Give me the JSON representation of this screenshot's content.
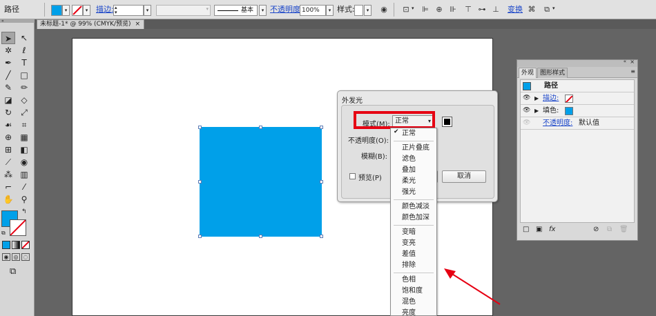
{
  "control_bar": {
    "object_type": "路径",
    "stroke_label": "描边:",
    "line_style": "基本",
    "opacity_label": "不透明度:",
    "opacity_value": "100%",
    "style_label": "样式:",
    "transform_label": "变换",
    "colors": {
      "fill": "#00a0e9",
      "stroke_slash": "#e60012"
    }
  },
  "document_tab": {
    "title": "未标题-1* @ 99% (CMYK/预览)",
    "close": "×"
  },
  "toolbar": {
    "tools": [
      {
        "name": "selection-tool",
        "glyph": "➤"
      },
      {
        "name": "direct-selection-tool",
        "glyph": "↖"
      },
      {
        "name": "magic-wand-tool",
        "glyph": "✲"
      },
      {
        "name": "lasso-tool",
        "glyph": "ℓ"
      },
      {
        "name": "pen-tool",
        "glyph": "✒"
      },
      {
        "name": "type-tool",
        "glyph": "T"
      },
      {
        "name": "line-tool",
        "glyph": "╱"
      },
      {
        "name": "rectangle-tool",
        "glyph": "□"
      },
      {
        "name": "paintbrush-tool",
        "glyph": "✎"
      },
      {
        "name": "pencil-tool",
        "glyph": "✏"
      },
      {
        "name": "blob-brush-tool",
        "glyph": "◪"
      },
      {
        "name": "eraser-tool",
        "glyph": "◇"
      },
      {
        "name": "rotate-tool",
        "glyph": "↻"
      },
      {
        "name": "scale-tool",
        "glyph": "⤢"
      },
      {
        "name": "warp-tool",
        "glyph": "☙"
      },
      {
        "name": "free-transform-tool",
        "glyph": "⌗"
      },
      {
        "name": "shape-builder-tool",
        "glyph": "⊕"
      },
      {
        "name": "perspective-grid-tool",
        "glyph": "▦"
      },
      {
        "name": "mesh-tool",
        "glyph": "⊞"
      },
      {
        "name": "gradient-tool",
        "glyph": "◧"
      },
      {
        "name": "eyedropper-tool",
        "glyph": "⟋"
      },
      {
        "name": "blend-tool",
        "glyph": "◉"
      },
      {
        "name": "symbol-sprayer-tool",
        "glyph": "⁂"
      },
      {
        "name": "column-graph-tool",
        "glyph": "▥"
      },
      {
        "name": "artboard-tool",
        "glyph": "⌐"
      },
      {
        "name": "slice-tool",
        "glyph": "⁄"
      },
      {
        "name": "hand-tool",
        "glyph": "✋"
      },
      {
        "name": "zoom-tool",
        "glyph": "⚲"
      }
    ]
  },
  "dialog": {
    "title": "外发光",
    "mode_label": "模式(M):",
    "mode_value": "正常",
    "opacity_label": "不透明度(O):",
    "blur_label": "模糊(B):",
    "preview_label": "预览(P)",
    "cancel_label": "取消",
    "glow_color": "#000000"
  },
  "blend_modes": [
    [
      "正常"
    ],
    [
      "正片叠底",
      "滤色",
      "叠加",
      "柔光",
      "强光"
    ],
    [
      "颜色减淡",
      "颜色加深"
    ],
    [
      "变暗",
      "变亮",
      "差值",
      "排除"
    ],
    [
      "色相",
      "饱和度",
      "混色",
      "亮度"
    ]
  ],
  "appearance_panel": {
    "tabs": [
      "外观",
      "图形样式"
    ],
    "header": "路径",
    "rows": [
      {
        "label": "描边:",
        "link": true
      },
      {
        "label": "填色:",
        "link": false
      },
      {
        "label": "不透明度:",
        "value": "默认值",
        "link": true
      }
    ]
  },
  "annotation": {
    "color": "#e60012"
  }
}
